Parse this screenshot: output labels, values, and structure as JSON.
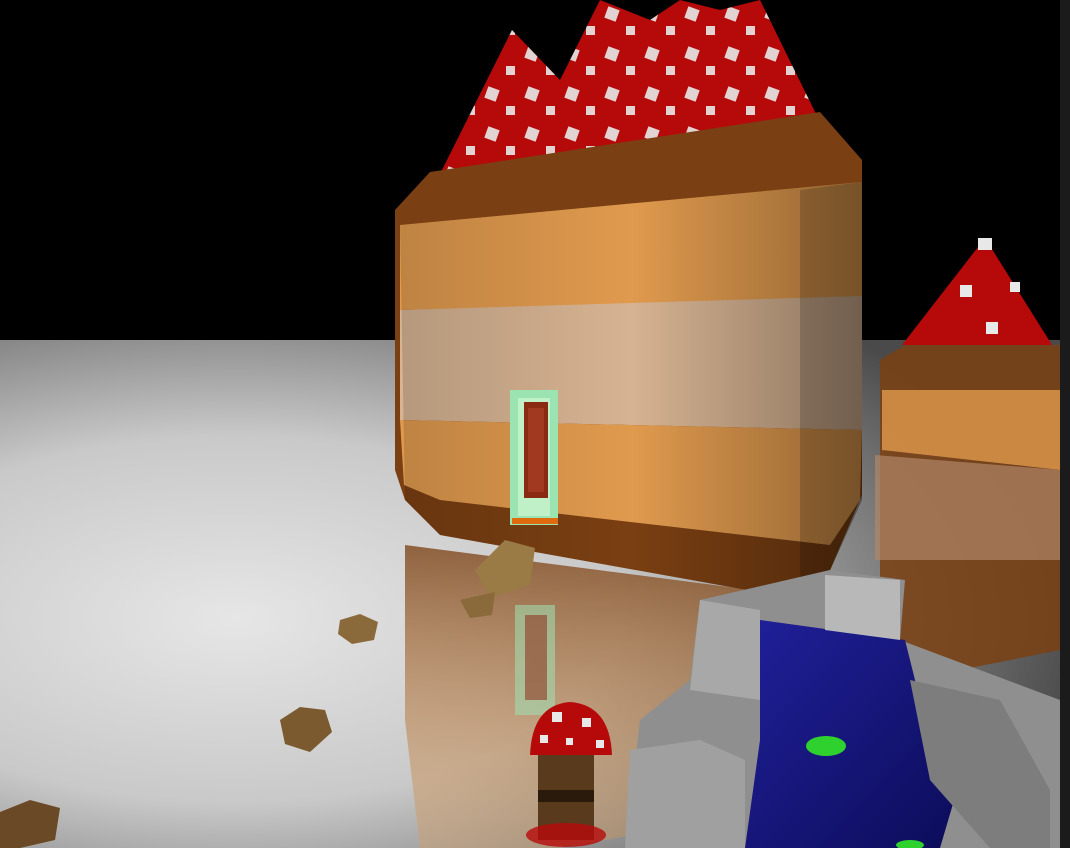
{
  "scene": {
    "colors": {
      "sky": "#000000",
      "floor_light": "#d8d8d8",
      "floor_dark": "#6a6a6a",
      "mushroom_red": "#b60a0a",
      "mushroom_spot": "#e8e8e8",
      "cake_brown": "#7a3f12",
      "cake_orange": "#e09a4e",
      "cake_cream": "#d6b392",
      "door_glow": "#9be3b0",
      "door_red": "#8b2a12",
      "rock_gray": "#9a9a9a",
      "water_blue": "#1a1a8a",
      "lily_green": "#2ed12e",
      "stone": "#8a6a3a"
    }
  }
}
